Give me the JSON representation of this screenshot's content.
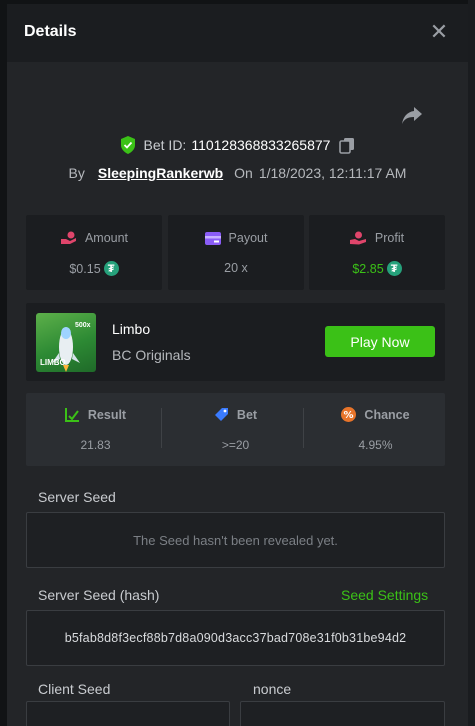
{
  "header": {
    "title": "Details",
    "close_icon": "close-icon"
  },
  "bet": {
    "id_label": "Bet ID:",
    "id_value": "110128368833265877",
    "by_label": "By",
    "user": "SleepingRankerwb",
    "on_label": "On",
    "date": "1/18/2023, 12:11:17 AM",
    "icons": {
      "verified": "shield-check-icon",
      "copy": "copy-icon",
      "share": "share-icon"
    }
  },
  "stats": {
    "amount": {
      "label": "Amount",
      "value": "$0.15",
      "icon": "coin-hand-icon",
      "currency_icon": "tether-icon"
    },
    "payout": {
      "label": "Payout",
      "value": "20 x",
      "icon": "wallet-icon"
    },
    "profit": {
      "label": "Profit",
      "value": "$2.85",
      "icon": "hand-money-icon",
      "currency_icon": "tether-icon"
    }
  },
  "game": {
    "name": "Limbo",
    "provider": "BC Originals",
    "play_label": "Play Now",
    "thumb_multiplier": "500x",
    "thumb_title": "LIMBO"
  },
  "result": {
    "result": {
      "label": "Result",
      "value": "21.83",
      "icon": "chart-check-icon"
    },
    "bet": {
      "label": "Bet",
      "value": ">=20",
      "icon": "tag-icon"
    },
    "chance": {
      "label": "Chance",
      "value": "4.95%",
      "icon": "percent-icon"
    }
  },
  "seeds": {
    "server_seed_label": "Server Seed",
    "server_seed_placeholder": "The Seed hasn't been revealed yet.",
    "server_seed_hash_label": "Server Seed (hash)",
    "seed_settings_label": "Seed Settings",
    "server_seed_hash_value": "b5fab8d8f3ecf88b7d8a090d3acc37bad708e31f0b31be94d2",
    "client_seed_label": "Client Seed",
    "nonce_label": "nonce"
  },
  "colors": {
    "accent_green": "#3bc117",
    "tether": "#26a17b",
    "amount_icon": "#e0456b",
    "payout_icon": "#8a5cf6",
    "profit_icon": "#e0456b",
    "bet_icon": "#3a7bff",
    "chance_icon": "#e8742a"
  }
}
